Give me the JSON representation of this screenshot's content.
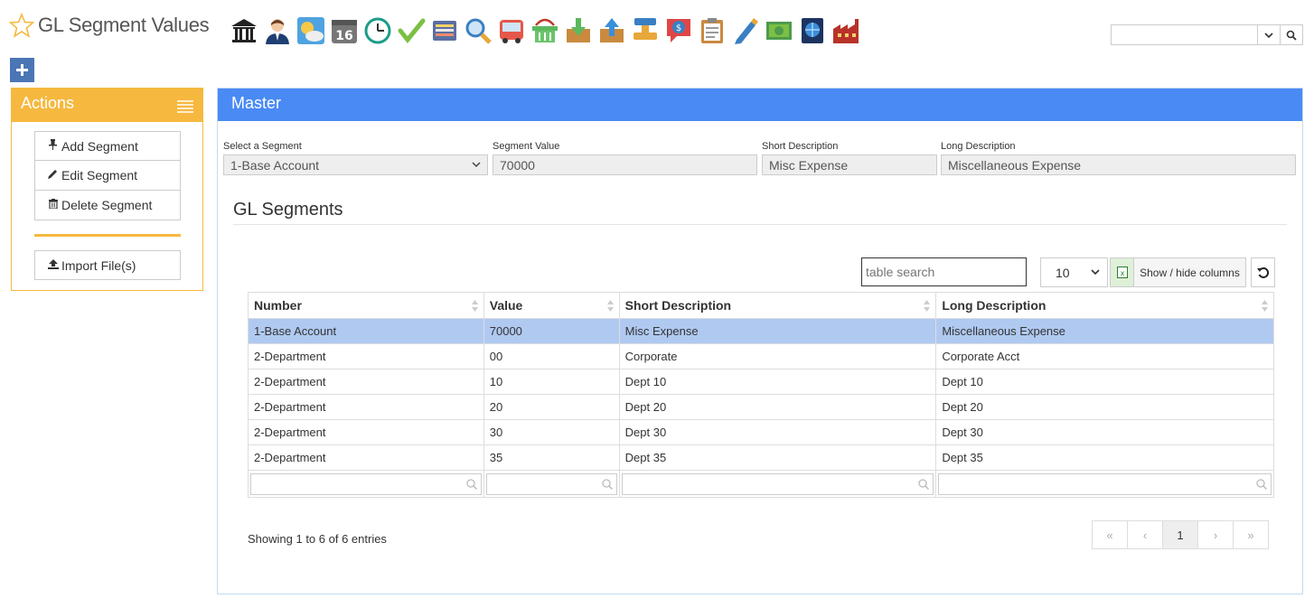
{
  "page": {
    "title": "GL Segment Values"
  },
  "toolbar": {
    "icons": [
      "bank-icon",
      "user-icon",
      "weather-icon",
      "calendar-icon",
      "clock-icon",
      "check-icon",
      "list-icon",
      "magnifier-icon",
      "bus-icon",
      "basket-icon",
      "download-box-icon",
      "upload-box-icon",
      "stamp-icon",
      "dollar-alert-icon",
      "clipboard-icon",
      "pencil-icon",
      "money-icon",
      "globe-book-icon",
      "factory-icon"
    ],
    "calendar_day": "16"
  },
  "search": {
    "value": ""
  },
  "actions": {
    "title": "Actions",
    "items": [
      {
        "label": "Add Segment",
        "icon": "pin-icon"
      },
      {
        "label": "Edit Segment",
        "icon": "pencil-icon"
      },
      {
        "label": "Delete Segment",
        "icon": "trash-icon"
      }
    ],
    "import": {
      "label": "Import File(s)",
      "icon": "upload-icon"
    }
  },
  "master": {
    "title": "Master",
    "fields": {
      "segment": {
        "label": "Select a Segment",
        "value": "1-Base Account"
      },
      "value": {
        "label": "Segment Value",
        "value": "70000"
      },
      "short": {
        "label": "Short Description",
        "value": "Misc Expense"
      },
      "long": {
        "label": "Long Description",
        "value": "Miscellaneous Expense"
      }
    }
  },
  "segments": {
    "title": "GL Segments",
    "search_placeholder": "table search",
    "page_length": "10",
    "show_hide_label": "Show / hide columns",
    "columns": [
      "Number",
      "Value",
      "Short Description",
      "Long Description"
    ],
    "rows": [
      [
        "1-Base Account",
        "70000",
        "Misc Expense",
        "Miscellaneous Expense"
      ],
      [
        "2-Department",
        "00",
        "Corporate",
        "Corporate Acct"
      ],
      [
        "2-Department",
        "10",
        "Dept 10",
        "Dept 10"
      ],
      [
        "2-Department",
        "20",
        "Dept 20",
        "Dept 20"
      ],
      [
        "2-Department",
        "30",
        "Dept 30",
        "Dept 30"
      ],
      [
        "2-Department",
        "35",
        "Dept 35",
        "Dept 35"
      ]
    ],
    "info": "Showing 1 to 6 of 6 entries",
    "pagination": {
      "first": "«",
      "prev": "‹",
      "current": "1",
      "next": "›",
      "last": "»"
    }
  },
  "colors": {
    "accent_orange": "#f6b83f",
    "header_blue": "#4a8af4",
    "selected_row": "#b0c9f1",
    "plus_button": "#4b76b6"
  }
}
